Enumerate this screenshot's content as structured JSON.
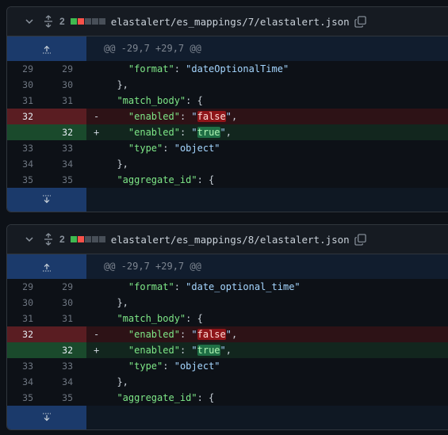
{
  "colors": {
    "diffstat_add": "#3fb950",
    "diffstat_del": "#f85149",
    "diffstat_neutral": "#484f58"
  },
  "files": [
    {
      "changes": "2",
      "path": "elastalert/es_mappings/7/elastalert.json",
      "hunk_header": "@@ -29,7 +29,7 @@",
      "lines": [
        {
          "old": "29",
          "new": "29",
          "sign": "",
          "code": "    \"format\": \"dateOptionalTime\""
        },
        {
          "old": "30",
          "new": "30",
          "sign": "",
          "code": "  },"
        },
        {
          "old": "31",
          "new": "31",
          "sign": "",
          "code": "  \"match_body\": {"
        },
        {
          "old": "32",
          "new": "",
          "sign": "-",
          "code": "    \"enabled\": \"false\","
        },
        {
          "old": "",
          "new": "32",
          "sign": "+",
          "code": "    \"enabled\": \"true\","
        },
        {
          "old": "33",
          "new": "33",
          "sign": "",
          "code": "    \"type\": \"object\""
        },
        {
          "old": "34",
          "new": "34",
          "sign": "",
          "code": "  },"
        },
        {
          "old": "35",
          "new": "35",
          "sign": "",
          "code": "  \"aggregate_id\": {"
        }
      ]
    },
    {
      "changes": "2",
      "path": "elastalert/es_mappings/8/elastalert.json",
      "hunk_header": "@@ -29,7 +29,7 @@",
      "lines": [
        {
          "old": "29",
          "new": "29",
          "sign": "",
          "code": "    \"format\": \"date_optional_time\""
        },
        {
          "old": "30",
          "new": "30",
          "sign": "",
          "code": "  },"
        },
        {
          "old": "31",
          "new": "31",
          "sign": "",
          "code": "  \"match_body\": {"
        },
        {
          "old": "32",
          "new": "",
          "sign": "-",
          "code": "    \"enabled\": \"false\","
        },
        {
          "old": "",
          "new": "32",
          "sign": "+",
          "code": "    \"enabled\": \"true\","
        },
        {
          "old": "33",
          "new": "33",
          "sign": "",
          "code": "    \"type\": \"object\""
        },
        {
          "old": "34",
          "new": "34",
          "sign": "",
          "code": "  },"
        },
        {
          "old": "35",
          "new": "35",
          "sign": "",
          "code": "  \"aggregate_id\": {"
        }
      ]
    }
  ]
}
